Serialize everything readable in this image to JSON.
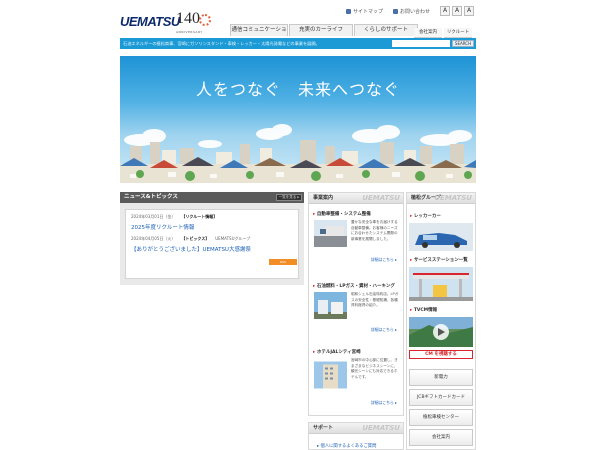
{
  "header": {
    "logo_text": "UEMATSU",
    "anniversary_number": "140",
    "anniversary_caption": "ANNIVERSARY",
    "sitemap_label": "サイトマップ",
    "contact_label": "お問い合わせ",
    "font_sizes": [
      "A",
      "A",
      "A"
    ],
    "tabs": [
      "通信コミュニケーション",
      "充実のカーライフ",
      "くらしのサポート"
    ],
    "subtabs": [
      "会社案内",
      "リクルート"
    ]
  },
  "bluebar": {
    "tagline": "石油エネルギーの植松商事、宮崎にガソリンスタンド・車検・レッカー・太陽光発電などの事業を展開。",
    "search_placeholder": "",
    "search_button": "SEARCH"
  },
  "hero": {
    "headline": "人をつなぐ　未来へつなぐ"
  },
  "news": {
    "title": "ニュース&トピックス",
    "more_label": "一覧を見る ▸",
    "items": [
      {
        "date": "2024年03月01日（金）",
        "category": "【リクルート情報】",
        "source": "",
        "link": "2025年度リクルート情報"
      },
      {
        "date": "2024年04月05日（火）",
        "category": "【トピックス】",
        "source": "UEMATSUグループ",
        "link": "【ありがとうございました】UEMATSU大感謝祭"
      }
    ],
    "rss_label": "RSS"
  },
  "business": {
    "title": "事業案内",
    "watermark": "UEMATSU",
    "sections": [
      {
        "title": "自動車整備・システム整備",
        "text": "豊かな安全な車をお届けする自動車整備。お客様のニーズにお合わせたシステム開発の新事業を展開しました。",
        "more": "詳細はこちら ▸"
      },
      {
        "title": "石油燃料・LPガス・資材・ハーキング",
        "text": "昭和シェル石油特約店。LPガスの安全性・基礎知識、各種資料館資の紹介。",
        "more": "詳細はこちら ▸"
      },
      {
        "title": "ホテルJALシティ宮崎",
        "text": "宮崎市の中心部に位置し、きまざまなビジネスシーンに、観光シーンにも対応できるホテルです。",
        "more": "詳細はこちら ▸"
      }
    ]
  },
  "support": {
    "title": "サポート",
    "watermark": "UEMATSU",
    "link": "▸ 個人に関するよくあるご質問"
  },
  "group": {
    "title": "植松グループ",
    "watermark": "UEMATSU",
    "items": [
      "レッカーカー",
      "サービスステーション一覧",
      "TVCM情報"
    ],
    "cm_button": "CM を視聴する",
    "buttons": [
      "新電力",
      "JCBギフトカードカード",
      "植松車検センター",
      "会社案内"
    ]
  }
}
